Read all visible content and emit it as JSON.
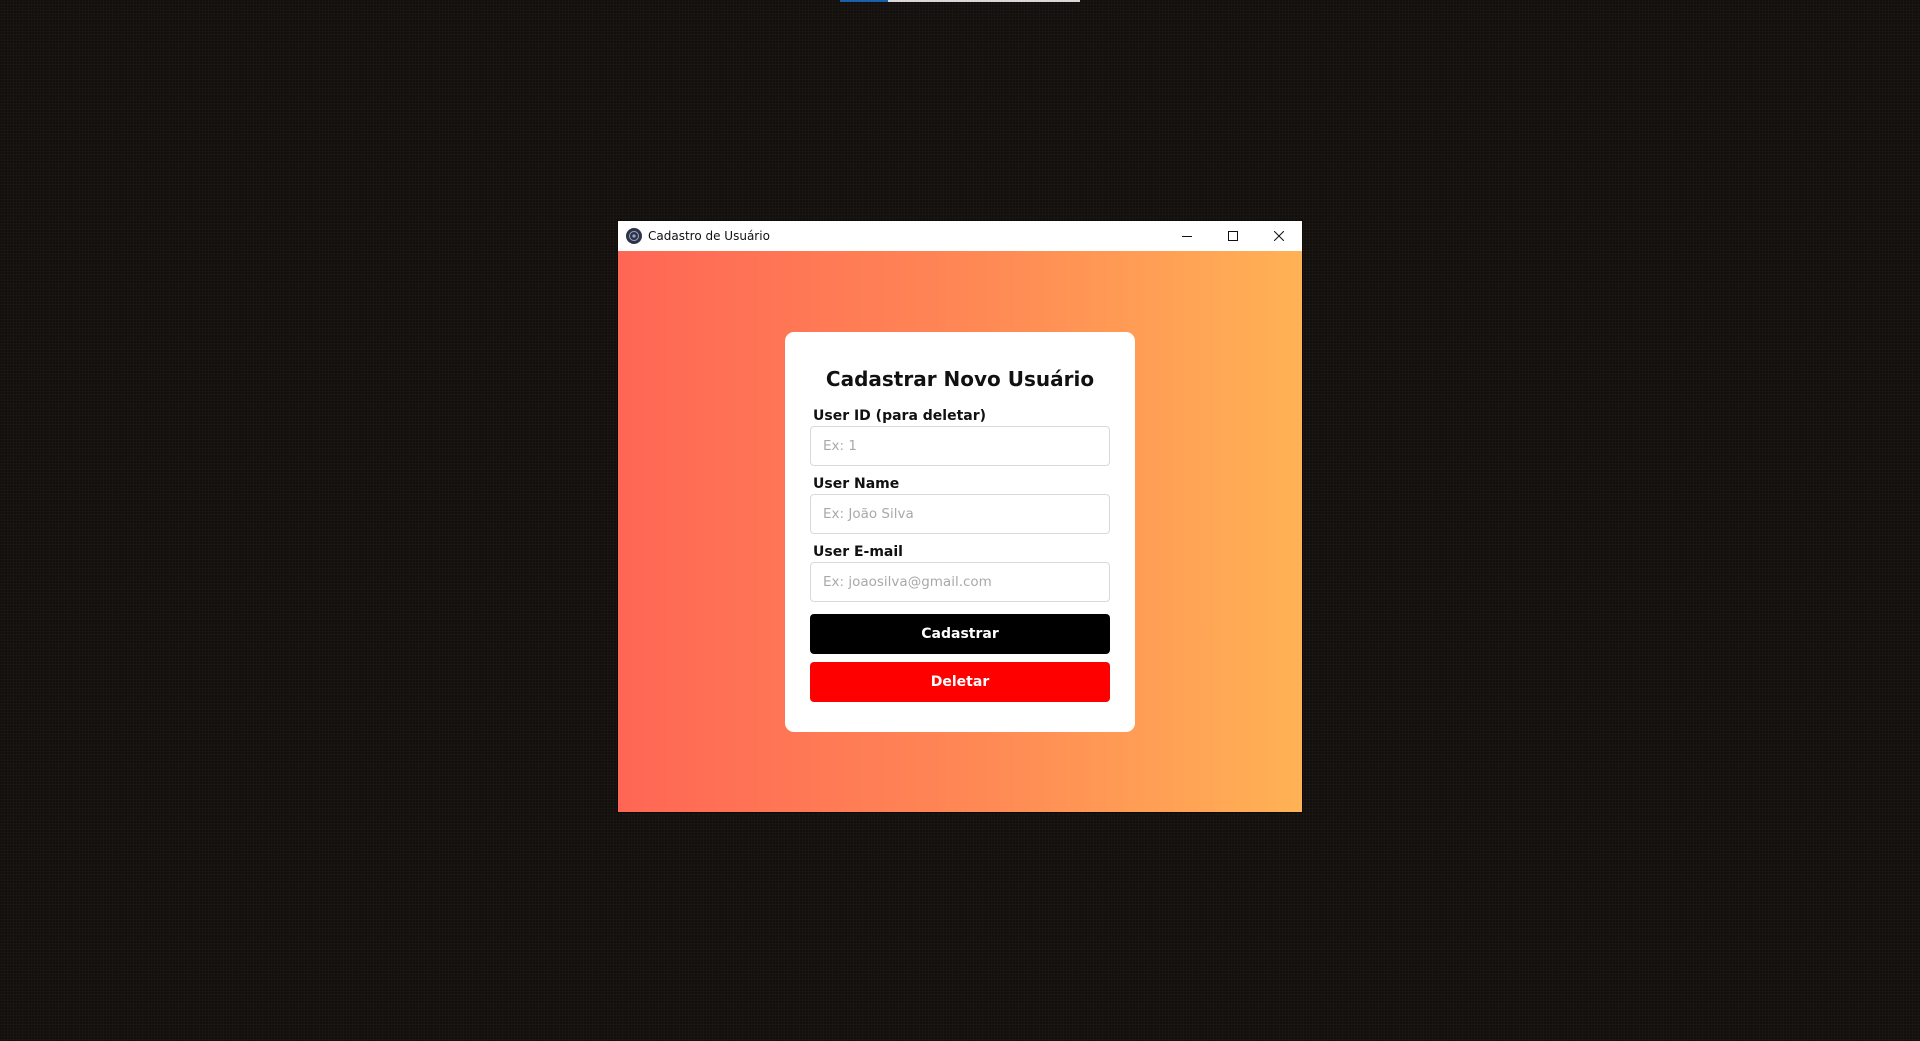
{
  "window": {
    "title": "Cadastro de Usuário",
    "controls": {
      "minimize_icon": "minimize-icon",
      "maximize_icon": "maximize-icon",
      "close_icon": "close-icon"
    }
  },
  "form": {
    "heading": "Cadastrar Novo Usuário",
    "fields": [
      {
        "label": "User ID (para deletar)",
        "value": "",
        "placeholder": "Ex: 1"
      },
      {
        "label": "User Name",
        "value": "",
        "placeholder": "Ex: João Silva"
      },
      {
        "label": "User E-mail",
        "value": "",
        "placeholder": "Ex: joaosilva@gmail.com"
      }
    ],
    "buttons": {
      "register_label": "Cadastrar",
      "delete_label": "Deletar"
    }
  },
  "colors": {
    "gradient_start": "#ff6655",
    "gradient_end": "#ffb255",
    "register_button": "#000000",
    "delete_button": "#ff0000",
    "desktop_background": "#120f0c"
  }
}
